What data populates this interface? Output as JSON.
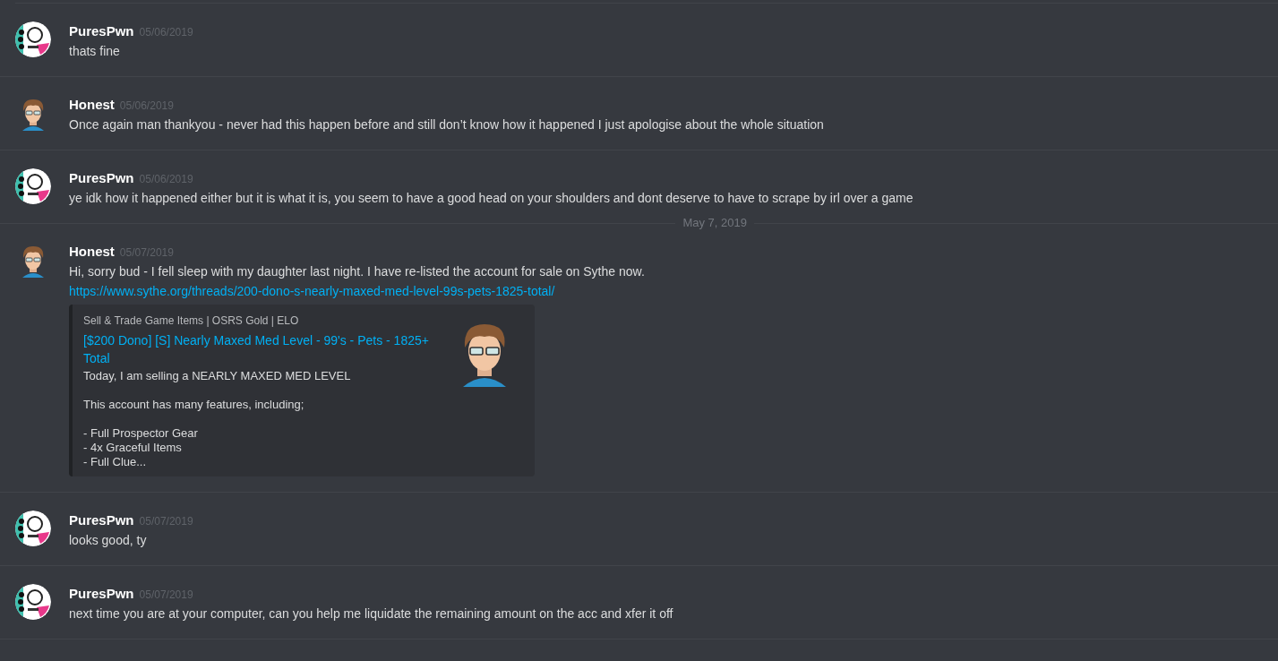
{
  "messages": [
    {
      "kind": "message",
      "avatar": {
        "kind": "badge"
      },
      "author": "PuresPwn",
      "timestamp": "05/06/2019",
      "text": "thats fine"
    },
    {
      "kind": "message",
      "avatar": {
        "kind": "person"
      },
      "author": "Honest",
      "timestamp": "05/06/2019",
      "text": "Once again man thankyou - never had this happen before and still don’t know how it happened I just apologise about the whole situation"
    },
    {
      "kind": "message",
      "avatar": {
        "kind": "badge"
      },
      "author": "PuresPwn",
      "timestamp": "05/06/2019",
      "text": "ye idk how it happened either but it is what it is, you seem to have a good head on your shoulders and dont deserve to have to scrape by irl over a game"
    },
    {
      "kind": "date_divider",
      "label": "May 7, 2019"
    },
    {
      "kind": "message",
      "avatar": {
        "kind": "person"
      },
      "author": "Honest",
      "timestamp": "05/07/2019",
      "text": "Hi, sorry bud - I fell sleep with my daughter last night. I have re-listed the account for sale on Sythe now.",
      "link": "https://www.sythe.org/threads/200-dono-s-nearly-maxed-med-level-99s-pets-1825-total/",
      "embed": {
        "provider": "Sell & Trade Game Items | OSRS Gold | ELO",
        "title": "[$200 Dono] [S] Nearly Maxed Med Level - 99's - Pets - 1825+ Total",
        "description": [
          [
            "Today, I am selling a NEARLY MAXED MED LEVEL"
          ],
          [
            "This account has many features, including;"
          ],
          [
            "- Full Prospector Gear",
            "- 4x Graceful Items",
            "- Full Clue..."
          ]
        ]
      }
    },
    {
      "kind": "message",
      "avatar": {
        "kind": "badge"
      },
      "author": "PuresPwn",
      "timestamp": "05/07/2019",
      "text": "looks good, ty"
    },
    {
      "kind": "message",
      "avatar": {
        "kind": "badge"
      },
      "author": "PuresPwn",
      "timestamp": "05/07/2019",
      "text": "next time you are at your computer, can you help me liquidate the remaining amount on the acc and xfer it off"
    }
  ]
}
